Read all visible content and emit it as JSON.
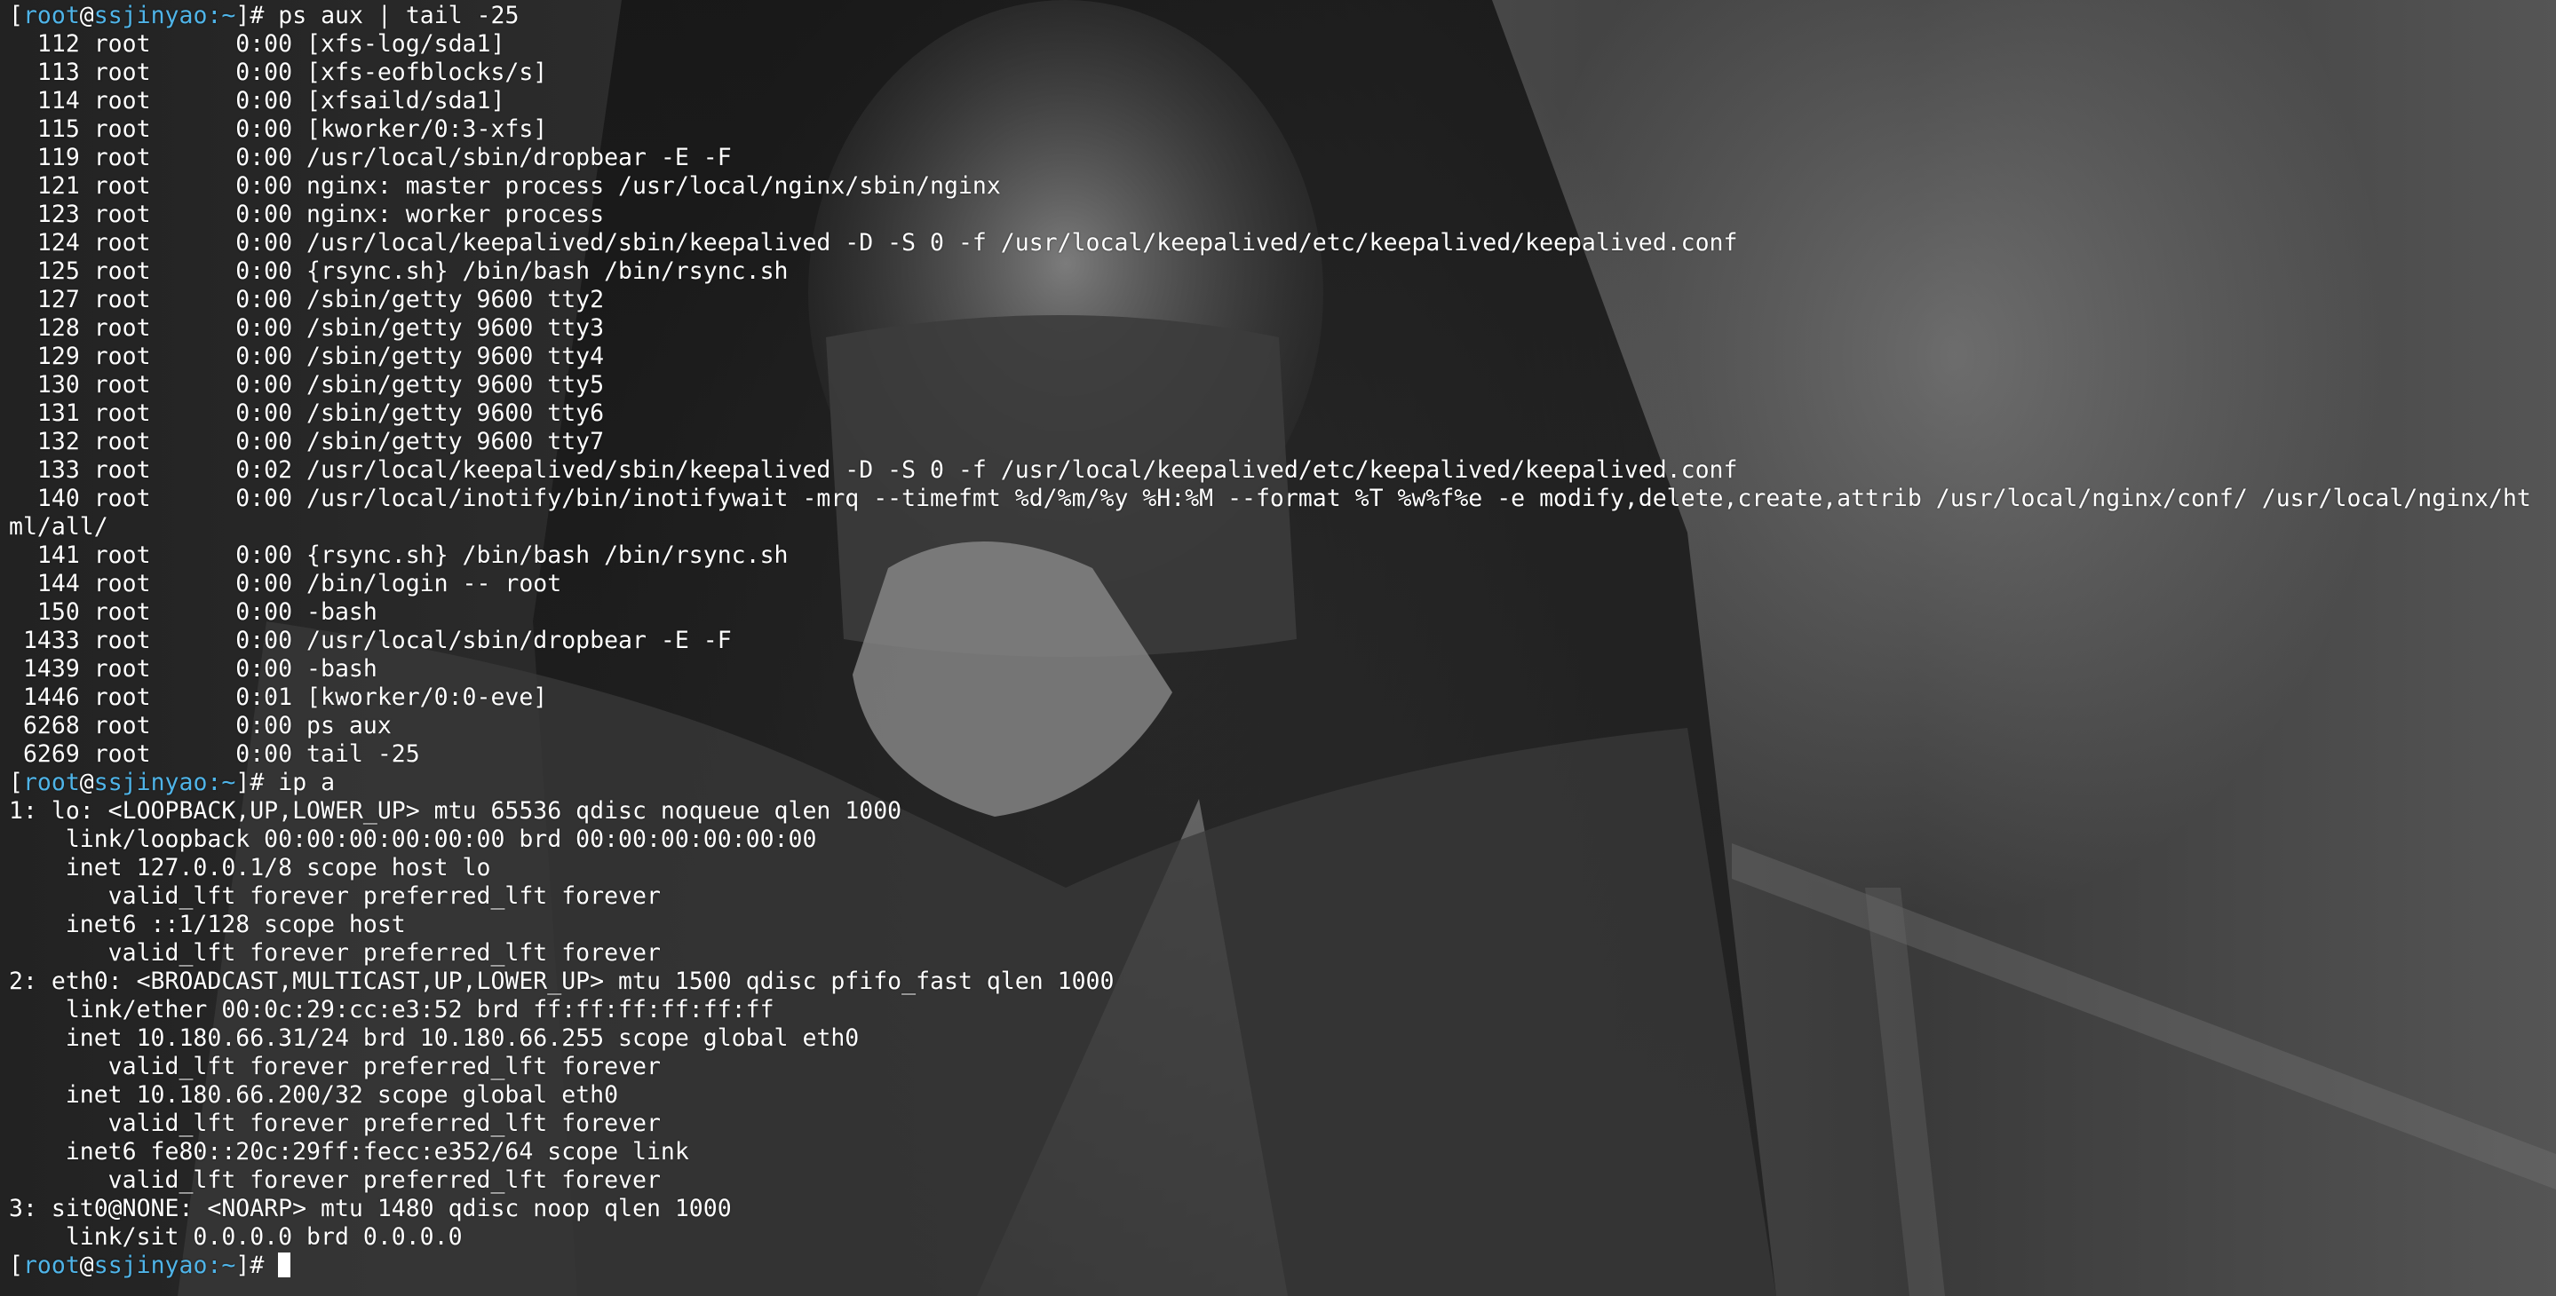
{
  "window": {
    "title": "root@ssjinyao: ~"
  },
  "wallpaper": {
    "description_icon": "photo-wallpaper-icon"
  },
  "colors": {
    "prompt_accent": "#4fb4e8",
    "text": "#ffffff"
  },
  "prompt": {
    "user": "root",
    "host": "ssjinyao",
    "path": "~",
    "symbol": "#"
  },
  "terminal": {
    "lines": [
      {
        "prompt": true,
        "cmd": " ps aux | tail -25"
      },
      {
        "text": "  112 root      0:00 [xfs-log/sda1]"
      },
      {
        "text": "  113 root      0:00 [xfs-eofblocks/s]"
      },
      {
        "text": "  114 root      0:00 [xfsaild/sda1]"
      },
      {
        "text": "  115 root      0:00 [kworker/0:3-xfs]"
      },
      {
        "text": "  119 root      0:00 /usr/local/sbin/dropbear -E -F"
      },
      {
        "text": "  121 root      0:00 nginx: master process /usr/local/nginx/sbin/nginx"
      },
      {
        "text": "  123 root      0:00 nginx: worker process"
      },
      {
        "text": "  124 root      0:00 /usr/local/keepalived/sbin/keepalived -D -S 0 -f /usr/local/keepalived/etc/keepalived/keepalived.conf"
      },
      {
        "text": "  125 root      0:00 {rsync.sh} /bin/bash /bin/rsync.sh"
      },
      {
        "text": "  127 root      0:00 /sbin/getty 9600 tty2"
      },
      {
        "text": "  128 root      0:00 /sbin/getty 9600 tty3"
      },
      {
        "text": "  129 root      0:00 /sbin/getty 9600 tty4"
      },
      {
        "text": "  130 root      0:00 /sbin/getty 9600 tty5"
      },
      {
        "text": "  131 root      0:00 /sbin/getty 9600 tty6"
      },
      {
        "text": "  132 root      0:00 /sbin/getty 9600 tty7"
      },
      {
        "text": "  133 root      0:02 /usr/local/keepalived/sbin/keepalived -D -S 0 -f /usr/local/keepalived/etc/keepalived/keepalived.conf"
      },
      {
        "text": "  140 root      0:00 /usr/local/inotify/bin/inotifywait -mrq --timefmt %d/%m/%y %H:%M --format %T %w%f%e -e modify,delete,create,attrib /usr/local/nginx/conf/ /usr/local/nginx/ht"
      },
      {
        "text": "ml/all/"
      },
      {
        "text": "  141 root      0:00 {rsync.sh} /bin/bash /bin/rsync.sh"
      },
      {
        "text": "  144 root      0:00 /bin/login -- root"
      },
      {
        "text": "  150 root      0:00 -bash"
      },
      {
        "text": " 1433 root      0:00 /usr/local/sbin/dropbear -E -F"
      },
      {
        "text": " 1439 root      0:00 -bash"
      },
      {
        "text": " 1446 root      0:01 [kworker/0:0-eve]"
      },
      {
        "text": " 6268 root      0:00 ps aux"
      },
      {
        "text": " 6269 root      0:00 tail -25"
      },
      {
        "prompt": true,
        "cmd": " ip a"
      },
      {
        "text": "1: lo: <LOOPBACK,UP,LOWER_UP> mtu 65536 qdisc noqueue qlen 1000"
      },
      {
        "text": "    link/loopback 00:00:00:00:00:00 brd 00:00:00:00:00:00"
      },
      {
        "text": "    inet 127.0.0.1/8 scope host lo"
      },
      {
        "text": "       valid_lft forever preferred_lft forever"
      },
      {
        "text": "    inet6 ::1/128 scope host"
      },
      {
        "text": "       valid_lft forever preferred_lft forever"
      },
      {
        "text": "2: eth0: <BROADCAST,MULTICAST,UP,LOWER_UP> mtu 1500 qdisc pfifo_fast qlen 1000"
      },
      {
        "text": "    link/ether 00:0c:29:cc:e3:52 brd ff:ff:ff:ff:ff:ff"
      },
      {
        "text": "    inet 10.180.66.31/24 brd 10.180.66.255 scope global eth0"
      },
      {
        "text": "       valid_lft forever preferred_lft forever"
      },
      {
        "text": "    inet 10.180.66.200/32 scope global eth0"
      },
      {
        "text": "       valid_lft forever preferred_lft forever"
      },
      {
        "text": "    inet6 fe80::20c:29ff:fecc:e352/64 scope link"
      },
      {
        "text": "       valid_lft forever preferred_lft forever"
      },
      {
        "text": "3: sit0@NONE: <NOARP> mtu 1480 qdisc noop qlen 1000"
      },
      {
        "text": "    link/sit 0.0.0.0 brd 0.0.0.0"
      },
      {
        "prompt": true,
        "cmd": " ",
        "cursor": true
      }
    ]
  }
}
